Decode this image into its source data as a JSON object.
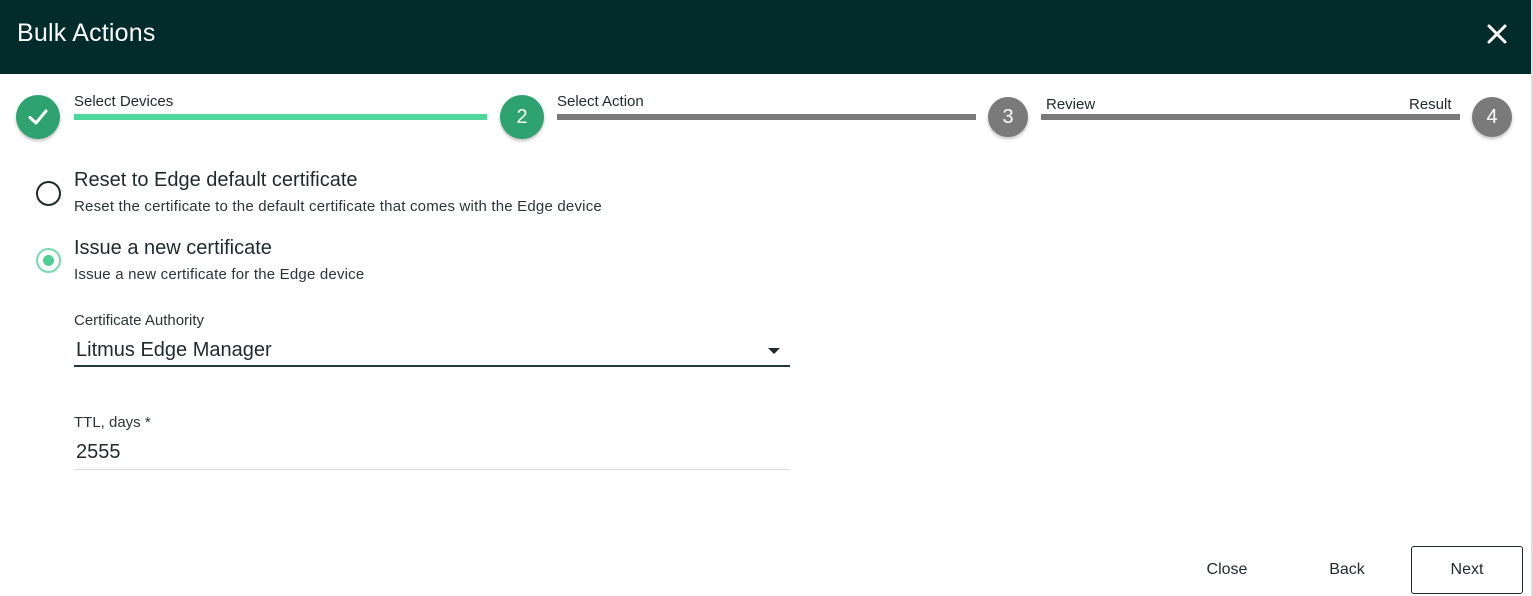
{
  "dialog": {
    "title": "Bulk Actions",
    "close_icon": "close-icon"
  },
  "stepper": {
    "steps": [
      {
        "number": "1",
        "label": "Select Devices",
        "state": "completed",
        "icon": "checkmark-icon"
      },
      {
        "number": "2",
        "label": "Select Action",
        "state": "active"
      },
      {
        "number": "3",
        "label": "Review",
        "state": "pending"
      },
      {
        "number": "4",
        "label": "Result",
        "state": "pending"
      }
    ]
  },
  "options": [
    {
      "title": "Reset to Edge default certificate",
      "description": "Reset the certificate to the default certificate that comes with the Edge device",
      "selected": false
    },
    {
      "title": "Issue a new certificate",
      "description": "Issue a new certificate for the Edge device",
      "selected": true
    }
  ],
  "form": {
    "certificate_authority": {
      "label": "Certificate Authority",
      "value": "Litmus Edge Manager"
    },
    "ttl": {
      "label": "TTL, days *",
      "value": "2555"
    }
  },
  "footer": {
    "close_label": "Close",
    "back_label": "Back",
    "next_label": "Next"
  },
  "colors": {
    "header_bg": "#022b2b",
    "accent_green": "#2ea36f",
    "progress_green": "#4fd69a",
    "pending_gray": "#7a7a7a"
  }
}
